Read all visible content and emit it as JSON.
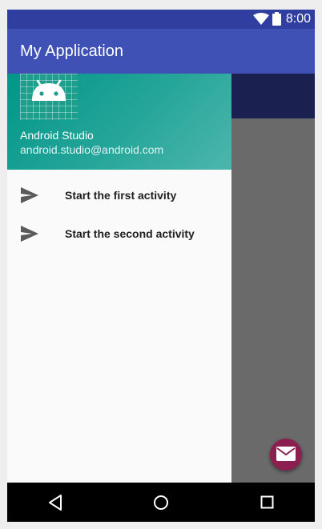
{
  "status_bar": {
    "time": "8:00",
    "icons": [
      "wifi-icon",
      "battery-icon"
    ]
  },
  "toolbar": {
    "title": "My Application"
  },
  "drawer": {
    "header": {
      "avatar_icon": "android-icon",
      "name": "Android Studio",
      "email": "android.studio@android.com"
    },
    "items": [
      {
        "icon": "send-icon",
        "label": "Start the first activity"
      },
      {
        "icon": "send-icon",
        "label": "Start the second activity"
      }
    ]
  },
  "fab": {
    "icon": "email-icon"
  },
  "nav_bar": {
    "buttons": [
      "back-icon",
      "home-icon",
      "recents-icon"
    ]
  },
  "colors": {
    "primary": "#3f51b5",
    "primary_dark": "#303f9f",
    "accent": "#8b1f4f",
    "drawer_header": "#009688"
  }
}
